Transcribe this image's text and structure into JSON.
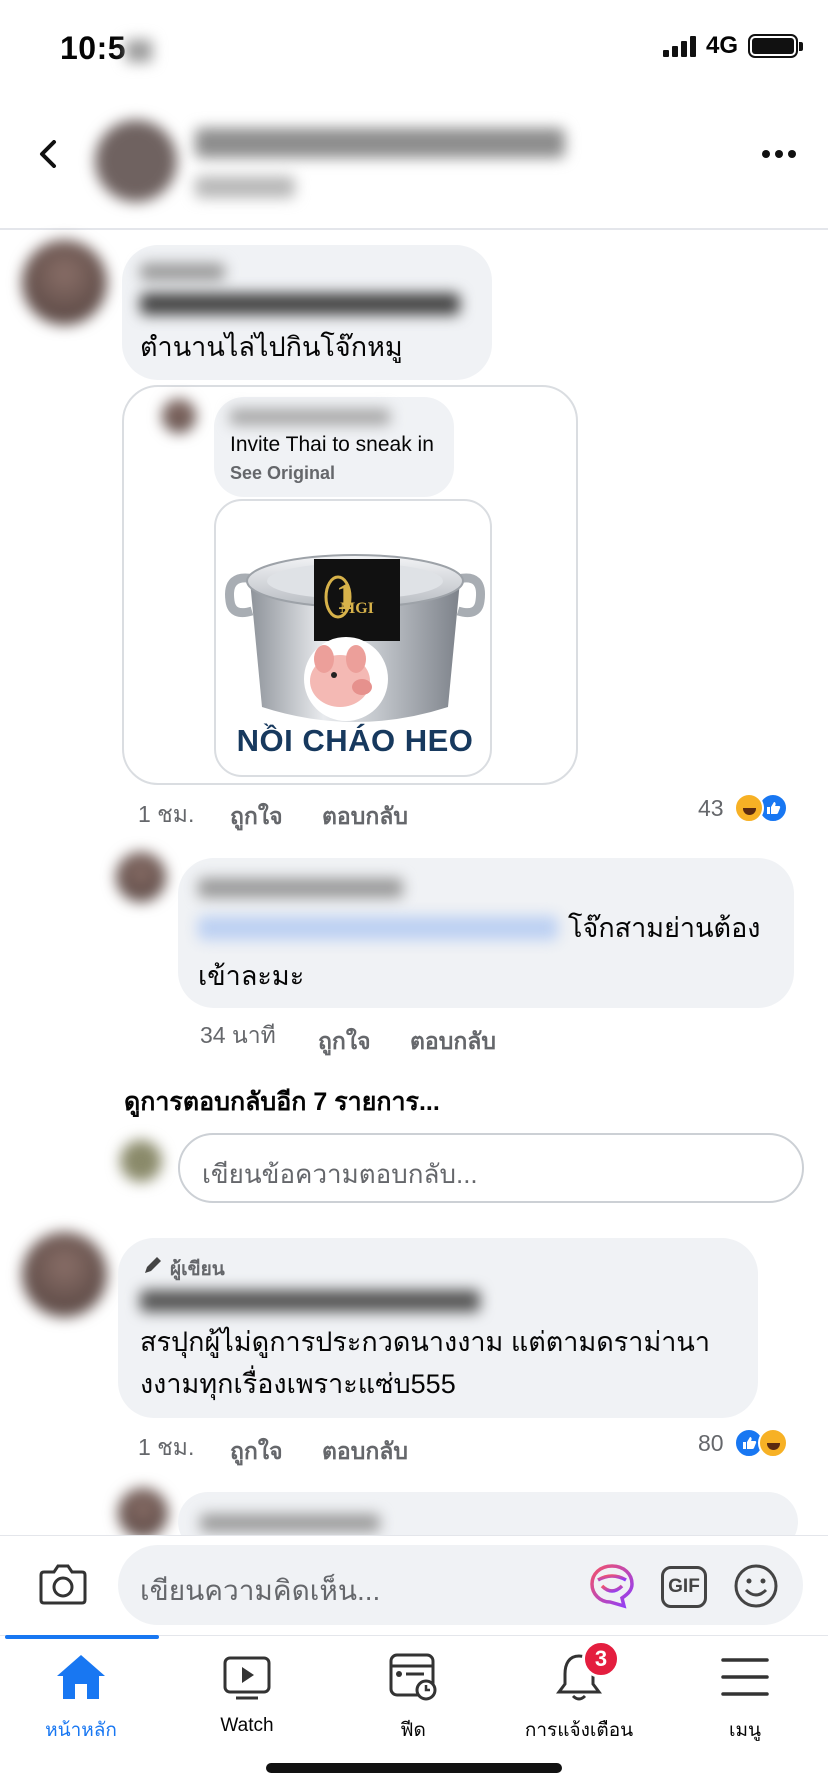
{
  "status_bar": {
    "time": "10:5",
    "network": "4G"
  },
  "post": {
    "image_label": "NỒI CHÁO HEO",
    "image_logo_text": "MGI"
  },
  "comments": [
    {
      "text": "ตำนานไล่ไปกินโจ๊กหมู",
      "shared": {
        "text": "Invite Thai to sneak in",
        "see_original": "See Original"
      },
      "time": "1 ชม.",
      "like": "ถูกใจ",
      "reply": "ตอบกลับ",
      "reaction_count": "43"
    },
    {
      "text_line1": "โจ๊กสามย่านต้อง",
      "text_line2": "เข้าละมะ",
      "time": "34 นาที",
      "like": "ถูกใจ",
      "reply": "ตอบกลับ"
    },
    {
      "author_badge": "ผู้เขียน",
      "text_line1": "สรปุกผู้ไม่ดูการประกวดนางงาม แต่ตามดราม่านา",
      "text_line2": "งงามทุกเรื่องเพราะแซ่บ555",
      "time": "1 ชม.",
      "like": "ถูกใจ",
      "reply": "ตอบกลับ",
      "reaction_count": "80"
    }
  ],
  "more_replies": "ดูการตอบกลับอีก 7 รายการ...",
  "reply_placeholder": "เขียนข้อความตอบกลับ...",
  "comment_placeholder": "เขียนความคิดเห็น...",
  "gif_label": "GIF",
  "tabs": [
    {
      "label": "หน้าหลัก",
      "icon": "home-icon",
      "active": true
    },
    {
      "label": "Watch",
      "icon": "watch-icon"
    },
    {
      "label": "ฟีด",
      "icon": "feed-icon"
    },
    {
      "label": "การแจ้งเตือน",
      "icon": "bell-icon",
      "badge": "3"
    },
    {
      "label": "เมนู",
      "icon": "menu-icon"
    }
  ],
  "colors": {
    "accent": "#1877f2",
    "badge": "#e41e3f",
    "bubble": "#f0f2f5"
  }
}
